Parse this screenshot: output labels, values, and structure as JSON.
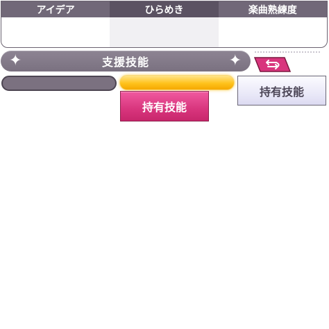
{
  "tabs": [
    {
      "label": "アイデア"
    },
    {
      "label": "ひらめき"
    },
    {
      "label": "楽曲熟練度"
    }
  ],
  "support_skill": {
    "title": "支援技能",
    "sparkle_icon": "sparkle-icon"
  },
  "swap_button": {
    "icon": "swap-arrows-icon",
    "color": "#d8357d"
  },
  "progress": {
    "left_bar_fill": 0.0,
    "right_bar_fill": 1.0
  },
  "owned_buttons": {
    "pink_label": "持有技能",
    "light_label": "持有技能"
  },
  "colors": {
    "accent_pink": "#d8357d",
    "gold": "#ffc21c",
    "tab_gray": "#716878"
  }
}
